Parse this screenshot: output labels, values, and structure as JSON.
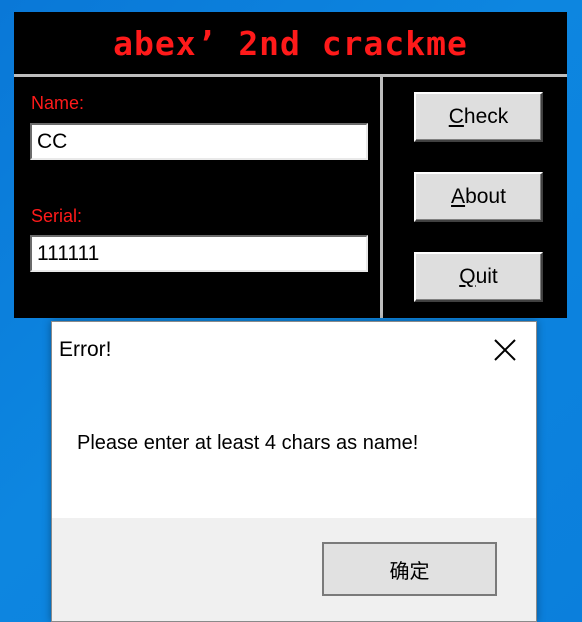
{
  "crackme_window": {
    "title": "abex’ 2nd crackme",
    "name_label": "Name:",
    "name_value": "CC",
    "serial_label": "Serial:",
    "serial_value": "111111",
    "buttons": {
      "check": {
        "mnemonic": "C",
        "rest": "heck"
      },
      "about": {
        "mnemonic": "A",
        "rest": "bout"
      },
      "quit": {
        "mnemonic": "Q",
        "rest": "uit"
      }
    },
    "colors": {
      "background": "#000000",
      "accent_text": "#ff1a1a",
      "divider": "#bdbdbd",
      "button_face": "#dedede"
    }
  },
  "error_dialog": {
    "title": "Error!",
    "message": "Please enter at least 4 chars as name!",
    "ok_button_label": "确定",
    "close_icon": "close-icon",
    "colors": {
      "body": "#ffffff",
      "footer": "#f0f0f0"
    }
  },
  "desktop": {
    "background_color": "#0b7fdc"
  }
}
